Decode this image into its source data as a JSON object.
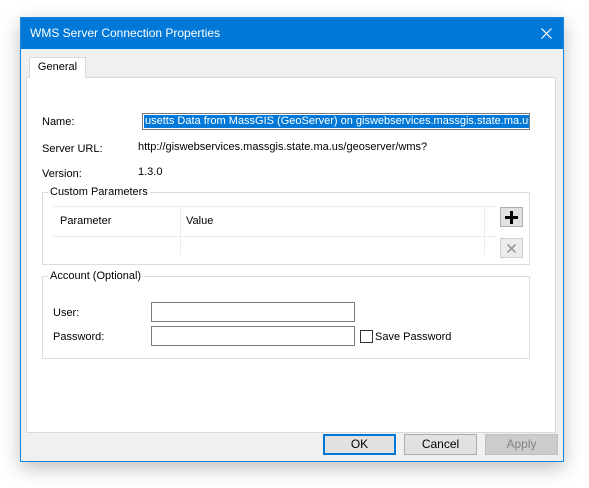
{
  "window": {
    "title": "WMS Server Connection Properties"
  },
  "tabs": [
    {
      "label": "General"
    }
  ],
  "form": {
    "name_label": "Name:",
    "name_value": "usetts Data from MassGIS (GeoServer) on giswebservices.massgis.state.ma.us",
    "server_url_label": "Server URL:",
    "server_url_value": "http://giswebservices.massgis.state.ma.us/geoserver/wms?",
    "version_label": "Version:",
    "version_value": "1.3.0"
  },
  "custom_parameters": {
    "title": "Custom Parameters",
    "columns": [
      "Parameter",
      "Value"
    ],
    "add_icon": "plus-icon",
    "remove_icon": "x-icon"
  },
  "account": {
    "title": "Account (Optional)",
    "user_label": "User:",
    "user_value": "",
    "password_label": "Password:",
    "password_value": "",
    "save_password_label": "Save Password",
    "save_password_checked": false
  },
  "buttons": {
    "ok": "OK",
    "cancel": "Cancel",
    "apply": "Apply"
  },
  "colors": {
    "titlebar": "#0078d7",
    "selection": "#0078d7",
    "dialog_bg": "#f0f0f0"
  }
}
